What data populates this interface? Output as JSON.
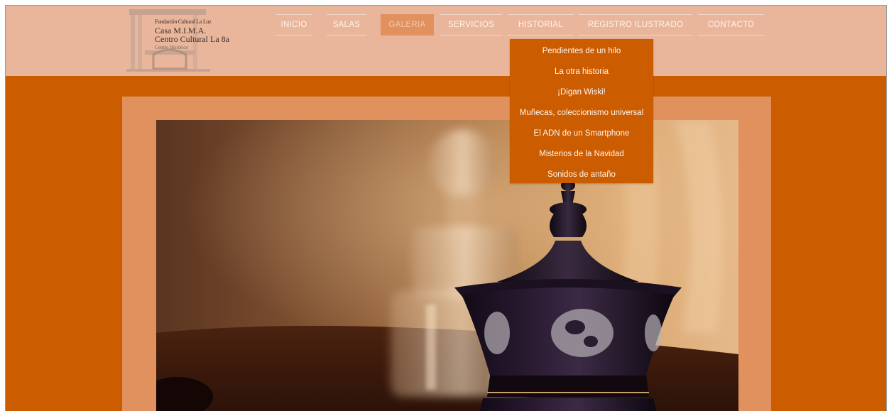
{
  "logo": {
    "line1": "Fundación Cultural La Luz",
    "line2": "Casa M.I.M.A.",
    "line3": "Centro Cultural La 8a",
    "line4": "Centro Histórico"
  },
  "nav": {
    "items": [
      {
        "label": "INICIO",
        "active": false
      },
      {
        "label": "SALAS",
        "active": false
      },
      {
        "label": "GALERIA",
        "active": true
      },
      {
        "label": "SERVICIOS",
        "active": false
      },
      {
        "label": "HISTORIAL",
        "active": false
      },
      {
        "label": "REGISTRO ILUSTRADO",
        "active": false
      },
      {
        "label": "CONTACTO",
        "active": false
      }
    ]
  },
  "dropdown": {
    "parent": "HISTORIAL",
    "items": [
      "Pendientes de un hilo",
      "La otra historia",
      "¡Digan Wiski!",
      "Muñecas, coleccionismo universal",
      "El ADN de un Smartphone",
      "Misterios de la Navidad",
      "Sonidos de antaño"
    ]
  },
  "colors": {
    "background": "#cc5c00",
    "header": "#e9b69c",
    "panel": "#e0915d",
    "active_nav": "#e0915d",
    "dropdown": "#cc5c00"
  }
}
